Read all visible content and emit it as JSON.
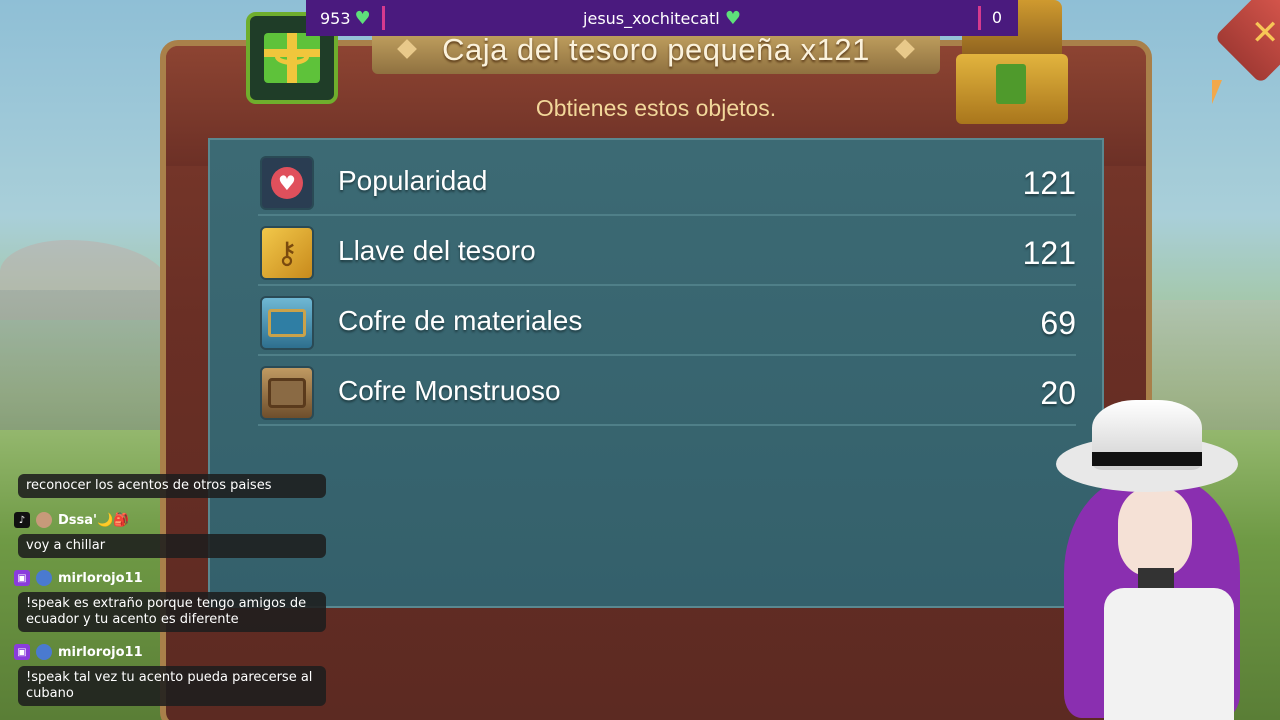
{
  "stream_bar": {
    "hearts_count": "953",
    "username": "jesus_xochitecatl",
    "counter": "0"
  },
  "dialog": {
    "title": "Caja del tesoro pequeña x121",
    "subtitle": "Obtienes estos objetos.",
    "items": [
      {
        "name": "Popularidad",
        "qty": "121",
        "icon": "heart-icon"
      },
      {
        "name": "Llave del tesoro",
        "qty": "121",
        "icon": "key-icon"
      },
      {
        "name": "Cofre de materiales",
        "qty": "69",
        "icon": "materials-chest-icon"
      },
      {
        "name": "Cofre Monstruoso",
        "qty": "20",
        "icon": "monster-chest-icon"
      }
    ]
  },
  "chat": {
    "messages": [
      {
        "text": "reconocer los acentos de otros paises"
      },
      {
        "user": "Dssa'🌙🎒",
        "platform": "tiktok",
        "text": "voy a chillar"
      },
      {
        "user": "mirlorojo11",
        "platform": "twitch",
        "text": "!speak es extraño porque tengo amigos de ecuador y tu acento es diferente"
      },
      {
        "user": "mirlorojo11",
        "platform": "twitch",
        "text": "!speak tal vez tu acento pueda parecerse al cubano"
      }
    ]
  },
  "colors": {
    "panel": "#6a2f25",
    "list": "#3c6a74",
    "accent_gold": "#c9a864",
    "stream_bar": "#4a1a7e"
  }
}
